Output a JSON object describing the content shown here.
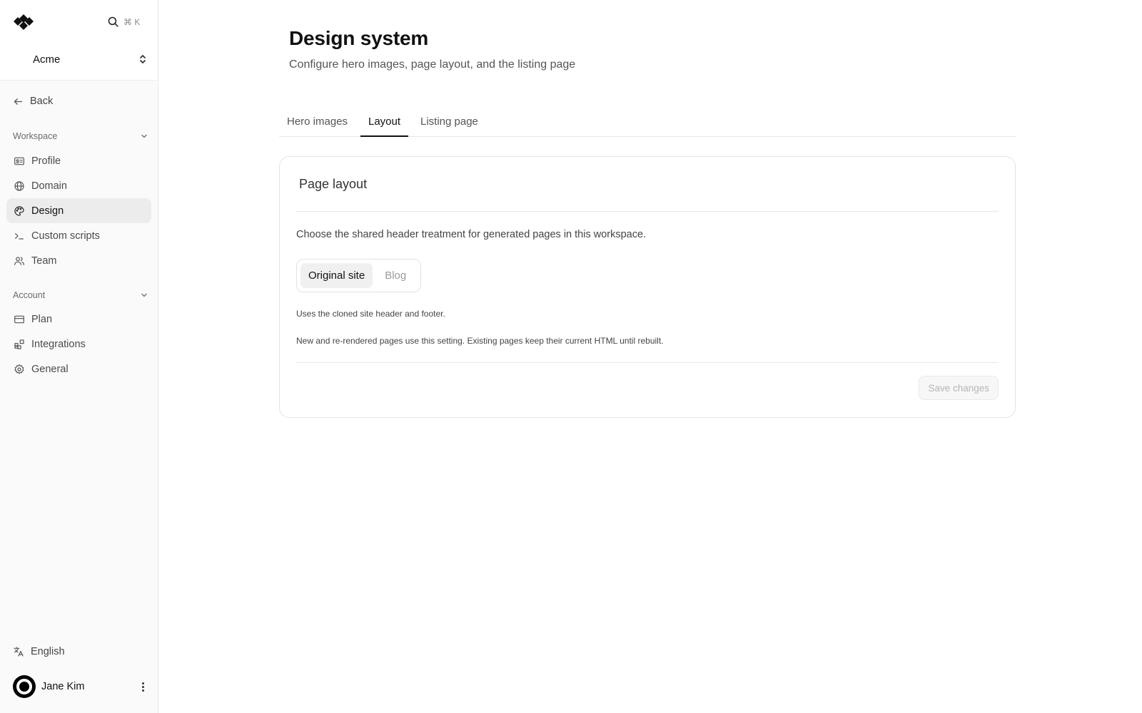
{
  "search": {
    "shortcut": "⌘ K"
  },
  "workspace": {
    "name": "Acme"
  },
  "sidebar": {
    "back_label": "Back",
    "workspace_section": "Workspace",
    "workspace_items": [
      {
        "label": "Profile",
        "icon": "id-card-icon"
      },
      {
        "label": "Domain",
        "icon": "globe-icon"
      },
      {
        "label": "Design",
        "icon": "palette-icon",
        "active": true
      },
      {
        "label": "Custom scripts",
        "icon": "terminal-icon"
      },
      {
        "label": "Team",
        "icon": "users-icon"
      }
    ],
    "account_section": "Account",
    "account_items": [
      {
        "label": "Plan",
        "icon": "credit-card-icon"
      },
      {
        "label": "Integrations",
        "icon": "blocks-icon"
      },
      {
        "label": "General",
        "icon": "gear-icon"
      }
    ],
    "language": "English",
    "user": {
      "name": "Jane Kim"
    }
  },
  "page": {
    "title": "Design system",
    "subtitle": "Configure hero images, page layout, and the listing page"
  },
  "tabs": [
    {
      "label": "Hero images"
    },
    {
      "label": "Layout",
      "active": true
    },
    {
      "label": "Listing page"
    }
  ],
  "card": {
    "title": "Page layout",
    "description": "Choose the shared header treatment for generated pages in this workspace.",
    "options": [
      {
        "label": "Original site",
        "selected": true
      },
      {
        "label": "Blog"
      }
    ],
    "help_primary": "Uses the cloned site header and footer.",
    "help_secondary": "New and re-rendered pages use this setting. Existing pages keep their current HTML until rebuilt.",
    "save_label": "Save changes"
  }
}
